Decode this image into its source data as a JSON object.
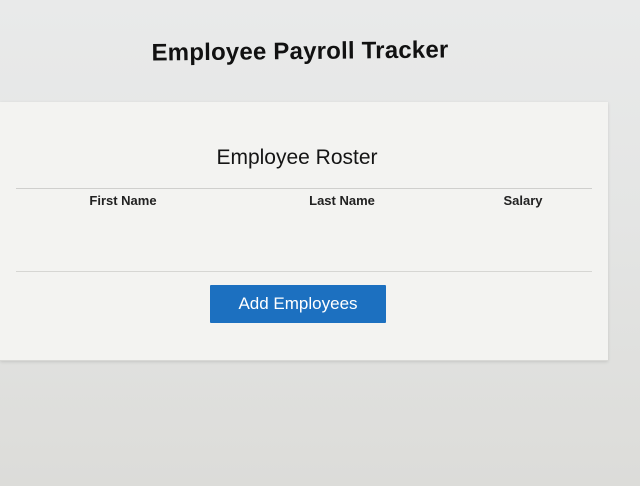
{
  "header": {
    "title": "Employee Payroll Tracker"
  },
  "roster": {
    "title": "Employee Roster",
    "columns": [
      "First Name",
      "Last Name",
      "Salary"
    ],
    "rows": []
  },
  "actions": {
    "add_label": "Add Employees"
  },
  "colors": {
    "button": "#1c70c0",
    "card": "#f3f3f1",
    "background": "#e6e7e6"
  }
}
